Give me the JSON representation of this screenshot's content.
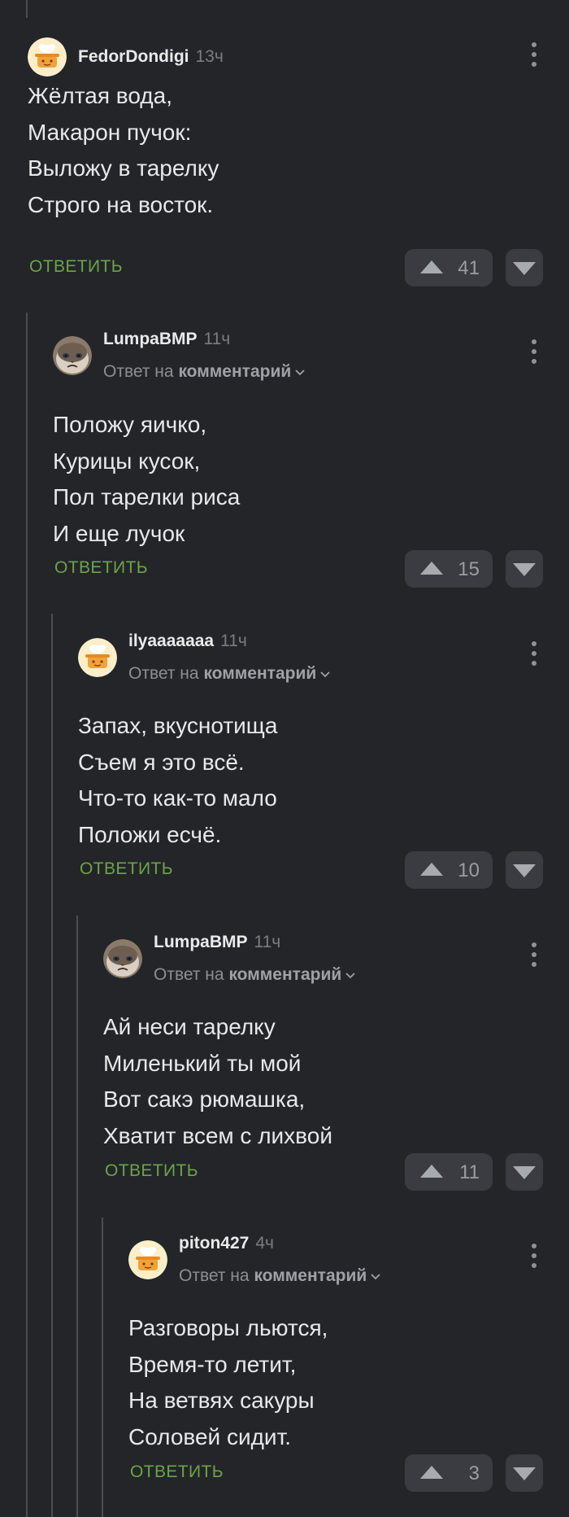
{
  "labels": {
    "reply_to_prefix": "Ответ на",
    "reply_to_link": "комментарий",
    "reply_button": "ОТВЕТИТЬ"
  },
  "comments": [
    {
      "author": "FedorDondigi",
      "time": "13ч",
      "avatar": "cooking-pot",
      "lines": [
        "Жёлтая вода,",
        "Макарон пучок:",
        "Выложу в тарелку",
        "Строго на восток."
      ],
      "rating": "41"
    },
    {
      "author": "LumpaBMP",
      "time": "11ч",
      "avatar": "grumpy-cat",
      "lines": [
        "Положу яичко,",
        "Курицы кусок,",
        "Пол тарелки риса",
        "И еще лучок"
      ],
      "rating": "15"
    },
    {
      "author": "ilyaaaaaaa",
      "time": "11ч",
      "avatar": "cooking-pot",
      "lines": [
        "Запах, вкуснотища",
        "Съем я это всё.",
        "Что-то как-то мало",
        "Положи есчё."
      ],
      "rating": "10"
    },
    {
      "author": "LumpaBMP",
      "time": "11ч",
      "avatar": "grumpy-cat",
      "lines": [
        "Ай неси тарелку",
        "Миленький ты мой",
        "Вот сакэ рюмашка,",
        "Хватит всем с лихвой"
      ],
      "rating": "11"
    },
    {
      "author": "piton427",
      "time": "4ч",
      "avatar": "cooking-pot",
      "lines": [
        "Разговоры льются,",
        "Время-то летит,",
        "На ветвях сакуры",
        "Соловей сидит."
      ],
      "rating": "3"
    }
  ],
  "colors": {
    "background": "#232529",
    "reply_green": "#6aa447",
    "vote_bg": "#3a3c41",
    "thread_line": "#4a4d52"
  }
}
